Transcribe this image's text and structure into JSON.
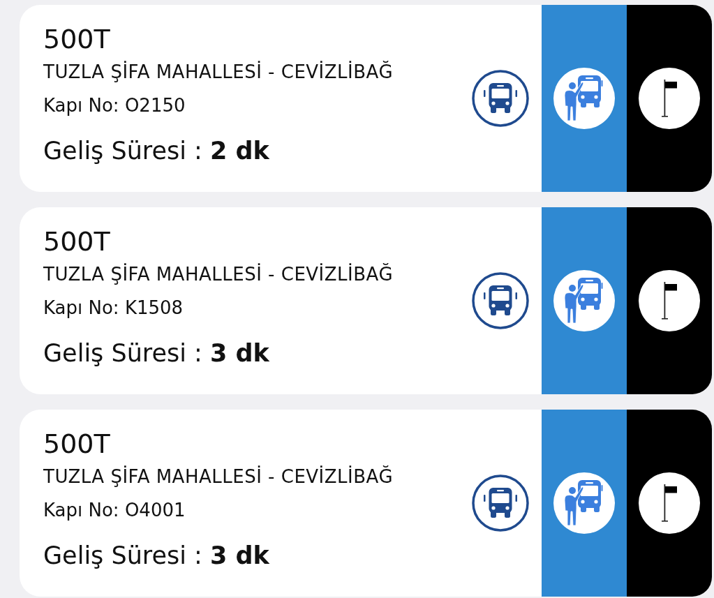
{
  "arrivals": [
    {
      "line": "500T",
      "route": "TUZLA ŞİFA MAHALLESİ - CEVİZLİBAĞ",
      "door_no": "Kapı No: O2150",
      "arrival_time": "Geliş Süresi : **2 dk**"
    },
    {
      "line": "500T",
      "route": "TUZLA ŞİFA MAHALLESİ - CEVİZLİBAĞ",
      "door_no": "Kapı No: K1508",
      "arrival_time": "Geliş Süresi : **3 dk**"
    },
    {
      "line": "500T",
      "route": "TUZLA ŞİFA MAHALLESİ - CEVİZLİBAĞ",
      "door_no": "Kapı No: O4001",
      "arrival_time": "Geliş Süresi : **3 dk**"
    }
  ]
}
